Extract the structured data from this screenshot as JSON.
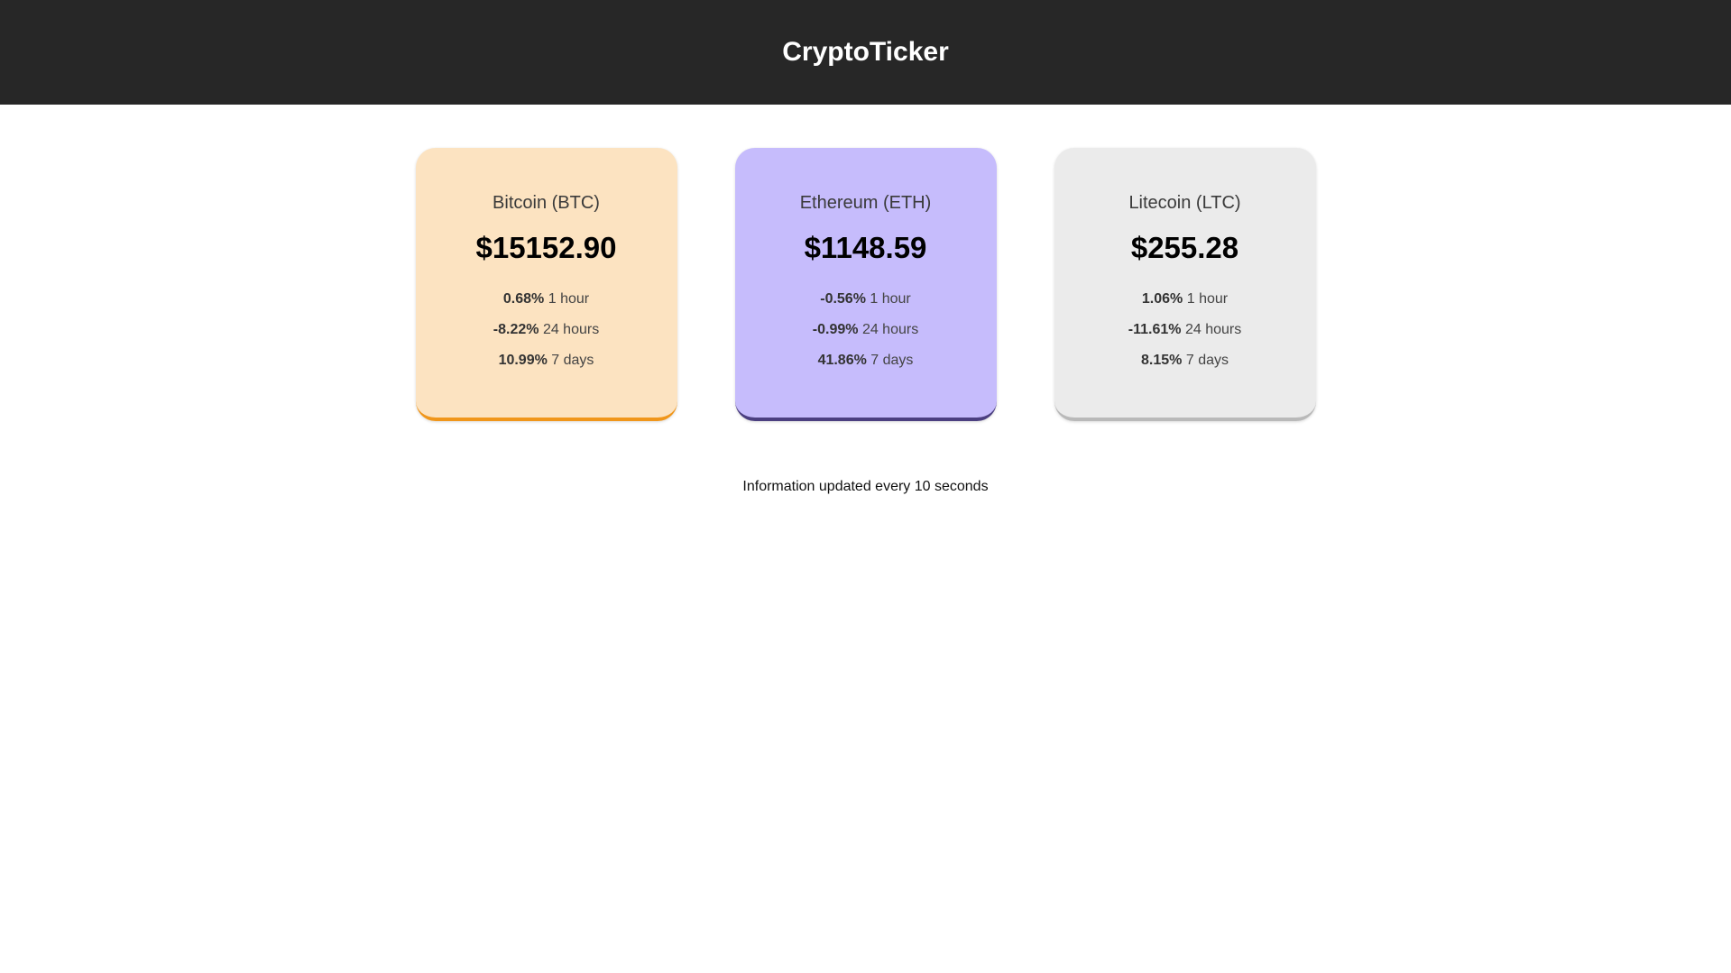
{
  "header": {
    "title": "CryptoTicker"
  },
  "cards": [
    {
      "name": "Bitcoin (BTC)",
      "price": "$15152.90",
      "bg": "#fce3c1",
      "accent": "#f0961b",
      "changes": [
        {
          "value": "0.68%",
          "period": "1 hour"
        },
        {
          "value": "-8.22%",
          "period": "24 hours"
        },
        {
          "value": "10.99%",
          "period": "7 days"
        }
      ]
    },
    {
      "name": "Ethereum (ETH)",
      "price": "$1148.59",
      "bg": "#c6bcfc",
      "accent": "#4b3f80",
      "changes": [
        {
          "value": "-0.56%",
          "period": "1 hour"
        },
        {
          "value": "-0.99%",
          "period": "24 hours"
        },
        {
          "value": "41.86%",
          "period": "7 days"
        }
      ]
    },
    {
      "name": "Litecoin (LTC)",
      "price": "$255.28",
      "bg": "#ebebeb",
      "accent": "#b9b9b9",
      "changes": [
        {
          "value": "1.06%",
          "period": "1 hour"
        },
        {
          "value": "-11.61%",
          "period": "24 hours"
        },
        {
          "value": "8.15%",
          "period": "7 days"
        }
      ]
    }
  ],
  "footer": {
    "text": "Information updated every 10 seconds"
  }
}
